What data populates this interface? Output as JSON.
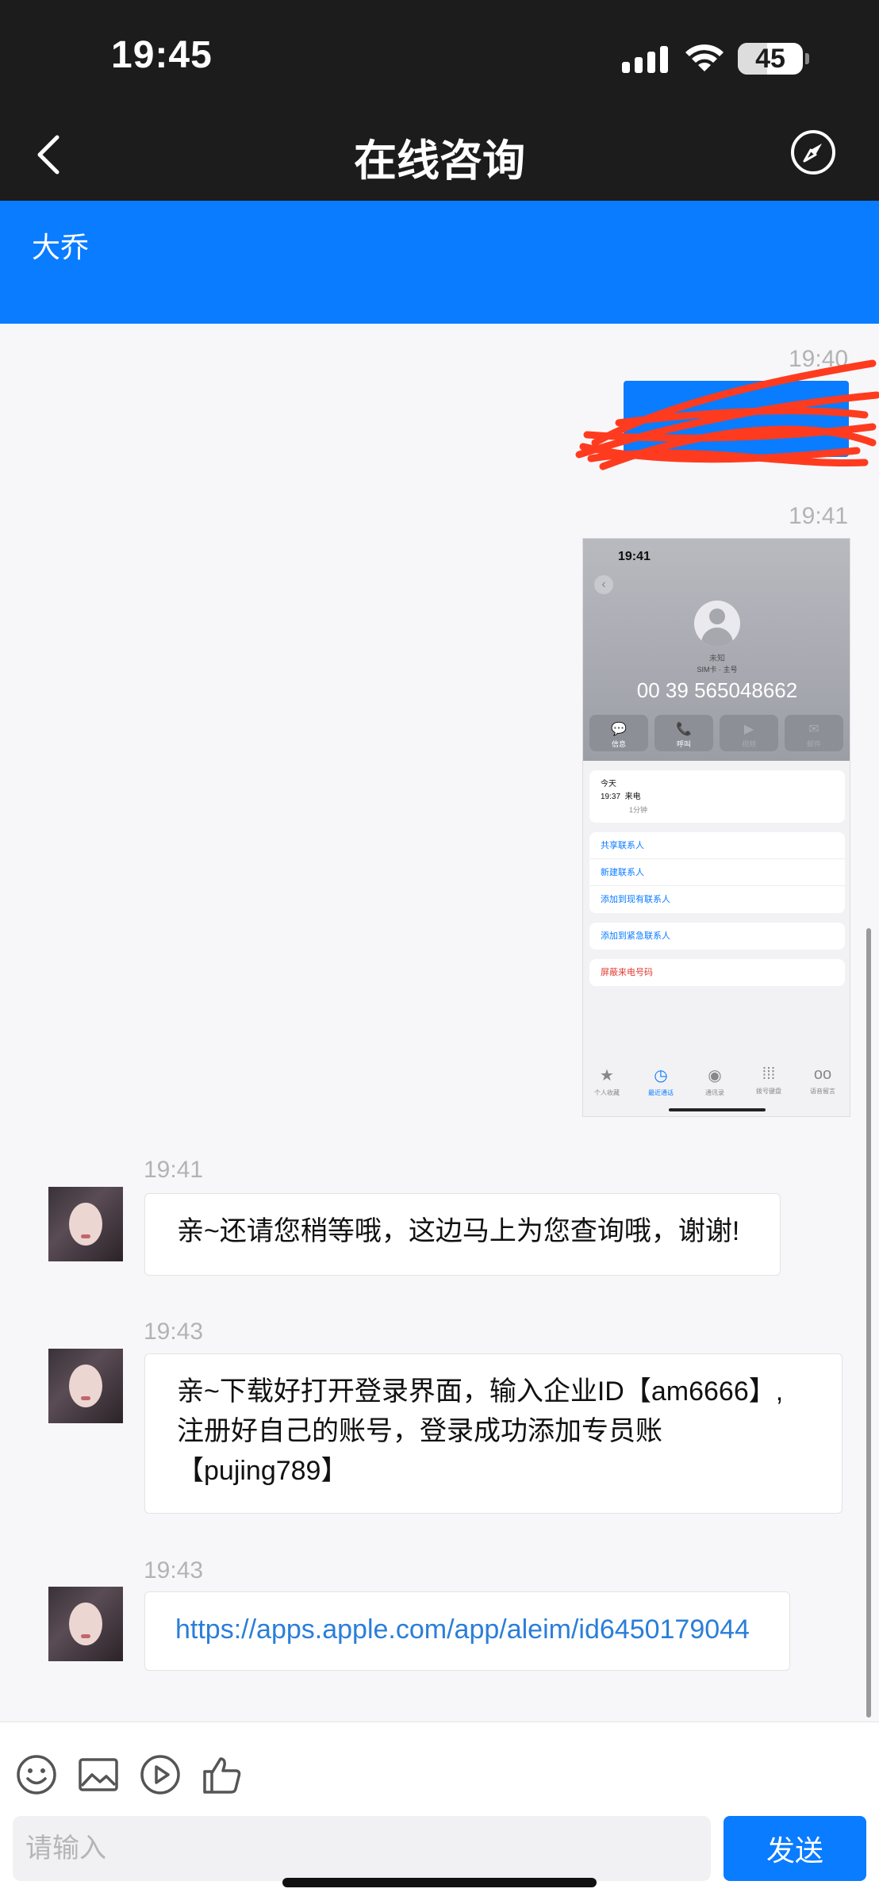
{
  "status_bar": {
    "time": "19:45",
    "battery": "45",
    "battery_fraction": 0.45
  },
  "nav": {
    "title": "在线咨询"
  },
  "agent": {
    "name": "大乔"
  },
  "messages": {
    "sent_text": {
      "time": "19:40"
    },
    "sent_image": {
      "time": "19:41",
      "screenshot": {
        "time": "19:41",
        "subtitle": "未知",
        "sim_label": "SIM卡 · 主号",
        "number": "00 39 565048662",
        "actions": [
          "信息",
          "呼叫",
          "视频",
          "邮件"
        ],
        "today_label": "今天",
        "call_time": "19:37",
        "call_type": "来电",
        "call_duration": "1分钟",
        "menu_group1": [
          "共享联系人",
          "新建联系人",
          "添加到现有联系人"
        ],
        "menu_group2": [
          "添加到紧急联系人"
        ],
        "menu_group3": [
          "屏蔽来电号码"
        ],
        "tabs": [
          "个人收藏",
          "最近通话",
          "通讯录",
          "拨号键盘",
          "语音留言"
        ]
      }
    },
    "received": [
      {
        "time": "19:41",
        "text": "亲~还请您稍等哦，这边马上为您查询哦，谢谢!"
      },
      {
        "time": "19:43",
        "text_line1": "亲~下载好打开登录界面，输入企业ID【am6666】,",
        "text_line2": "注册好自己的账号，登录成功添加专员账",
        "text_line3": "【pujing789】"
      },
      {
        "time": "19:43",
        "link": "https://apps.apple.com/app/aleim/id6450179044"
      }
    ]
  },
  "input": {
    "placeholder": "请输入",
    "send_label": "发送"
  },
  "colors": {
    "accent": "#0a7cff",
    "dark_bar": "#1c1c1c",
    "link": "#2a7ed8",
    "scribble": "#ff3b1f"
  }
}
